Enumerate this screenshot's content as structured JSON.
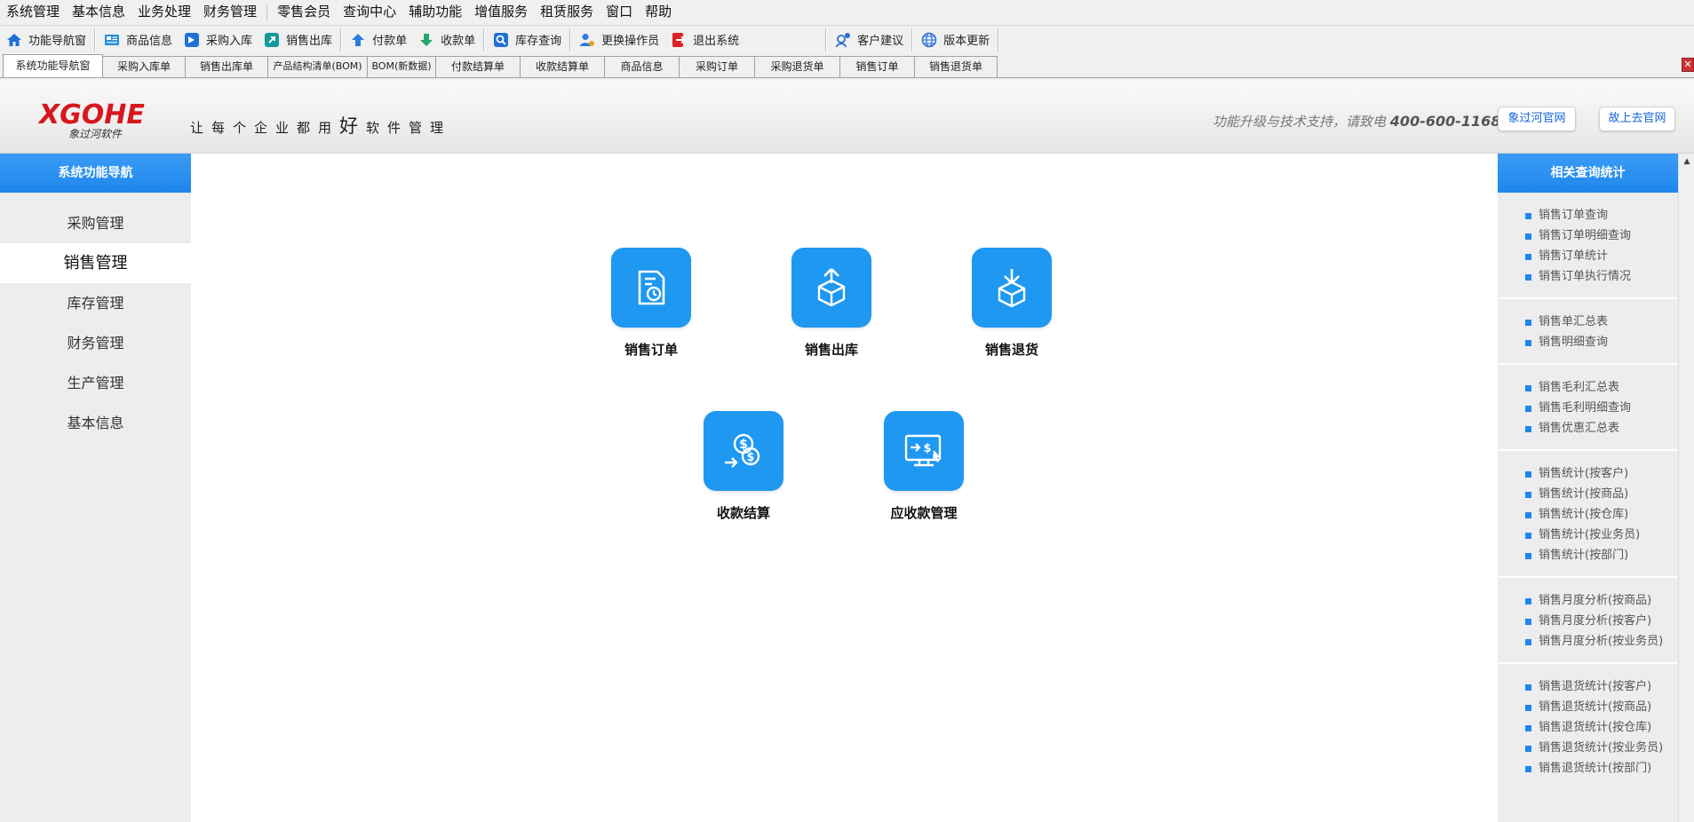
{
  "menu": [
    "系统管理",
    "基本信息",
    "业务处理",
    "财务管理",
    "零售会员",
    "查询中心",
    "辅助功能",
    "增值服务",
    "租赁服务",
    "窗口",
    "帮助"
  ],
  "toolbar": [
    {
      "label": "功能导航窗",
      "icon": "home-icon"
    },
    {
      "label": "商品信息",
      "icon": "product-icon"
    },
    {
      "label": "采购入库",
      "icon": "purchase-in-icon"
    },
    {
      "label": "销售出库",
      "icon": "sales-out-icon"
    },
    {
      "label": "付款单",
      "icon": "payment-icon"
    },
    {
      "label": "收款单",
      "icon": "receipt-icon"
    },
    {
      "label": "库存查询",
      "icon": "inventory-search-icon"
    },
    {
      "label": "更换操作员",
      "icon": "switch-user-icon"
    },
    {
      "label": "退出系统",
      "icon": "exit-icon"
    },
    {
      "label": "客户建议",
      "icon": "feedback-icon"
    },
    {
      "label": "版本更新",
      "icon": "update-globe-icon"
    }
  ],
  "tabs": [
    "系统功能导航窗",
    "采购入库单",
    "销售出库单",
    "产品结构清单(BOM)",
    "BOM(新数据)",
    "付款结算单",
    "收款结算单",
    "商品信息",
    "采购订单",
    "采购退货单",
    "销售订单",
    "销售退货单"
  ],
  "banner": {
    "logo": "XGOHE",
    "logo_sub": "象过河软件",
    "slogan_a": "让每个企业都用",
    "slogan_b": "好",
    "slogan_c": "软件管理",
    "support_text": "功能升级与技术支持，请致电",
    "support_phone": "400-600-1168",
    "btn_official": "象过河官网",
    "btn_forum": "故上去官网"
  },
  "left_nav": {
    "title": "系统功能导航",
    "items": [
      "采购管理",
      "销售管理",
      "库存管理",
      "财务管理",
      "生产管理",
      "基本信息"
    ],
    "active_index": 1
  },
  "functions": [
    {
      "label": "销售订单",
      "icon": "sales-order-icon"
    },
    {
      "label": "销售出库",
      "icon": "outbound-box-icon"
    },
    {
      "label": "销售退货",
      "icon": "return-box-icon"
    },
    {
      "label": "收款结算",
      "icon": "coin-settlement-icon"
    },
    {
      "label": "应收款管理",
      "icon": "receivables-monitor-icon"
    }
  ],
  "right_nav": {
    "title": "相关查询统计",
    "groups": [
      [
        "销售订单查询",
        "销售订单明细查询",
        "销售订单统计",
        "销售订单执行情况"
      ],
      [
        "销售单汇总表",
        "销售明细查询"
      ],
      [
        "销售毛利汇总表",
        "销售毛利明细查询",
        "销售优惠汇总表"
      ],
      [
        "销售统计(按客户)",
        "销售统计(按商品)",
        "销售统计(按仓库)",
        "销售统计(按业务员)",
        "销售统计(按部门)"
      ],
      [
        "销售月度分析(按商品)",
        "销售月度分析(按客户)",
        "销售月度分析(按业务员)"
      ],
      [
        "销售退货统计(按客户)",
        "销售退货统计(按商品)",
        "销售退货统计(按仓库)",
        "销售退货统计(按业务员)",
        "销售退货统计(按部门)"
      ]
    ]
  },
  "colors": {
    "accent": "#1e98f1",
    "brand_red": "#d7171f",
    "nav_blue": "#1f86ec"
  }
}
